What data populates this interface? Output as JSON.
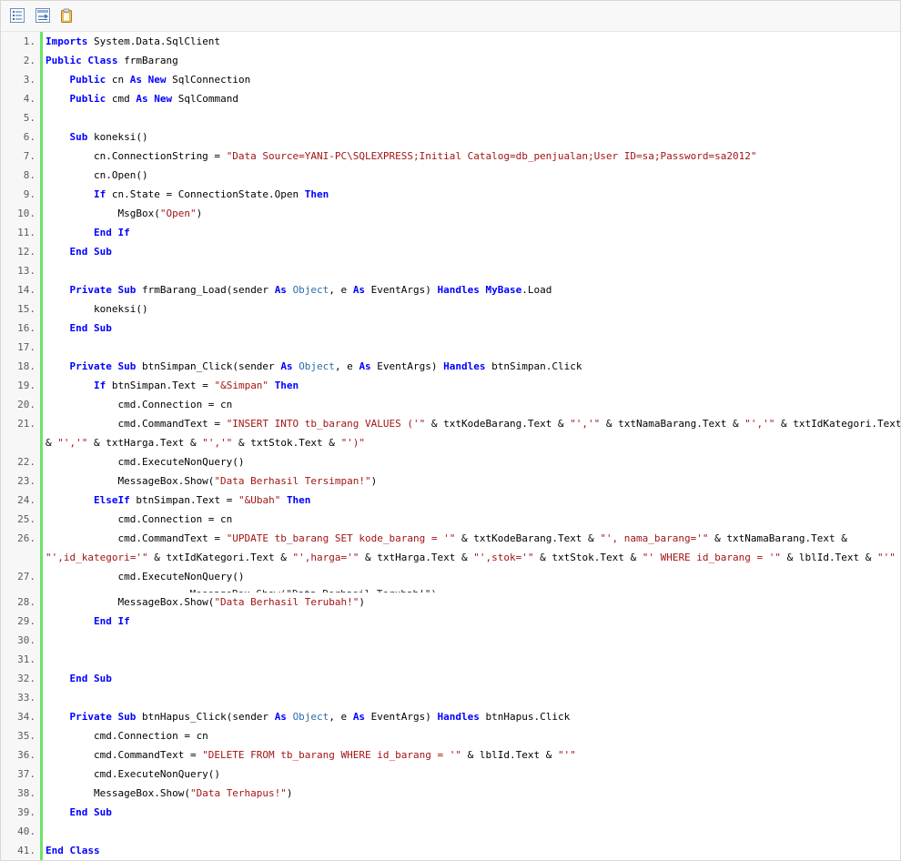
{
  "toolbar": {
    "buttons": [
      {
        "name": "view-source-icon"
      },
      {
        "name": "wrap-lines-icon"
      },
      {
        "name": "copy-clipboard-icon"
      }
    ]
  },
  "colors": {
    "keyword": "#0000ff",
    "type": "#2b6fa8",
    "string": "#a31515",
    "gutter_bar": "#6ce26c"
  },
  "code": {
    "lines": [
      {
        "n": "1.",
        "cont": "",
        "tokens": [
          {
            "c": "k",
            "t": "Imports"
          },
          {
            "c": "",
            "t": " System.Data.SqlClient"
          }
        ]
      },
      {
        "n": "2.",
        "cont": "",
        "tokens": [
          {
            "c": "k",
            "t": "Public"
          },
          {
            "c": "",
            "t": " "
          },
          {
            "c": "k",
            "t": "Class"
          },
          {
            "c": "",
            "t": " frmBarang"
          }
        ]
      },
      {
        "n": "3.",
        "cont": "",
        "tokens": [
          {
            "c": "",
            "t": "    "
          },
          {
            "c": "k",
            "t": "Public"
          },
          {
            "c": "",
            "t": " cn "
          },
          {
            "c": "k",
            "t": "As"
          },
          {
            "c": "",
            "t": " "
          },
          {
            "c": "k",
            "t": "New"
          },
          {
            "c": "",
            "t": " SqlConnection"
          }
        ]
      },
      {
        "n": "4.",
        "cont": "",
        "tokens": [
          {
            "c": "",
            "t": "    "
          },
          {
            "c": "k",
            "t": "Public"
          },
          {
            "c": "",
            "t": " cmd "
          },
          {
            "c": "k",
            "t": "As"
          },
          {
            "c": "",
            "t": " "
          },
          {
            "c": "k",
            "t": "New"
          },
          {
            "c": "",
            "t": " SqlCommand"
          }
        ]
      },
      {
        "n": "5.",
        "cont": "",
        "tokens": []
      },
      {
        "n": "6.",
        "cont": "",
        "tokens": [
          {
            "c": "",
            "t": "    "
          },
          {
            "c": "k",
            "t": "Sub"
          },
          {
            "c": "",
            "t": " koneksi()"
          }
        ]
      },
      {
        "n": "7.",
        "cont": "",
        "tokens": [
          {
            "c": "",
            "t": "        cn.ConnectionString = "
          },
          {
            "c": "s",
            "t": "\"Data Source=YANI-PC\\SQLEXPRESS;Initial Catalog=db_penjualan;User ID=sa;Password=sa2012\""
          }
        ]
      },
      {
        "n": "8.",
        "cont": "",
        "tokens": [
          {
            "c": "",
            "t": "        cn.Open()"
          }
        ]
      },
      {
        "n": "9.",
        "cont": "",
        "tokens": [
          {
            "c": "",
            "t": "        "
          },
          {
            "c": "k",
            "t": "If"
          },
          {
            "c": "",
            "t": " cn.State = ConnectionState.Open "
          },
          {
            "c": "k",
            "t": "Then"
          }
        ]
      },
      {
        "n": "10.",
        "cont": "",
        "tokens": [
          {
            "c": "",
            "t": "            MsgBox("
          },
          {
            "c": "s",
            "t": "\"Open\""
          },
          {
            "c": "",
            "t": ")"
          }
        ]
      },
      {
        "n": "11.",
        "cont": "",
        "tokens": [
          {
            "c": "",
            "t": "        "
          },
          {
            "c": "k",
            "t": "End"
          },
          {
            "c": "",
            "t": " "
          },
          {
            "c": "k",
            "t": "If"
          }
        ]
      },
      {
        "n": "12.",
        "cont": "",
        "tokens": [
          {
            "c": "",
            "t": "    "
          },
          {
            "c": "k",
            "t": "End"
          },
          {
            "c": "",
            "t": " "
          },
          {
            "c": "k",
            "t": "Sub"
          }
        ]
      },
      {
        "n": "13.",
        "cont": "",
        "tokens": []
      },
      {
        "n": "14.",
        "cont": "",
        "tokens": [
          {
            "c": "",
            "t": "    "
          },
          {
            "c": "k",
            "t": "Private"
          },
          {
            "c": "",
            "t": " "
          },
          {
            "c": "k",
            "t": "Sub"
          },
          {
            "c": "",
            "t": " frmBarang_Load(sender "
          },
          {
            "c": "k",
            "t": "As"
          },
          {
            "c": "",
            "t": " "
          },
          {
            "c": "t",
            "t": "Object"
          },
          {
            "c": "",
            "t": ", e "
          },
          {
            "c": "k",
            "t": "As"
          },
          {
            "c": "",
            "t": " EventArgs) "
          },
          {
            "c": "k",
            "t": "Handles"
          },
          {
            "c": "",
            "t": " "
          },
          {
            "c": "k",
            "t": "MyBase"
          },
          {
            "c": "",
            "t": ".Load"
          }
        ]
      },
      {
        "n": "15.",
        "cont": "",
        "tokens": [
          {
            "c": "",
            "t": "        koneksi()"
          }
        ]
      },
      {
        "n": "16.",
        "cont": "",
        "tokens": [
          {
            "c": "",
            "t": "    "
          },
          {
            "c": "k",
            "t": "End"
          },
          {
            "c": "",
            "t": " "
          },
          {
            "c": "k",
            "t": "Sub"
          }
        ]
      },
      {
        "n": "17.",
        "cont": "",
        "tokens": []
      },
      {
        "n": "18.",
        "cont": "",
        "tokens": [
          {
            "c": "",
            "t": "    "
          },
          {
            "c": "k",
            "t": "Private"
          },
          {
            "c": "",
            "t": " "
          },
          {
            "c": "k",
            "t": "Sub"
          },
          {
            "c": "",
            "t": " btnSimpan_Click(sender "
          },
          {
            "c": "k",
            "t": "As"
          },
          {
            "c": "",
            "t": " "
          },
          {
            "c": "t",
            "t": "Object"
          },
          {
            "c": "",
            "t": ", e "
          },
          {
            "c": "k",
            "t": "As"
          },
          {
            "c": "",
            "t": " EventArgs) "
          },
          {
            "c": "k",
            "t": "Handles"
          },
          {
            "c": "",
            "t": " btnSimpan.Click"
          }
        ]
      },
      {
        "n": "19.",
        "cont": "",
        "tokens": [
          {
            "c": "",
            "t": "        "
          },
          {
            "c": "k",
            "t": "If"
          },
          {
            "c": "",
            "t": " btnSimpan.Text = "
          },
          {
            "c": "s",
            "t": "\"&Simpan\""
          },
          {
            "c": "",
            "t": " "
          },
          {
            "c": "k",
            "t": "Then"
          }
        ]
      },
      {
        "n": "20.",
        "cont": "",
        "tokens": [
          {
            "c": "",
            "t": "            cmd.Connection = cn"
          }
        ]
      },
      {
        "n": "21.",
        "wrap": true,
        "tokens": [
          {
            "c": "",
            "t": "            cmd.CommandText = "
          },
          {
            "c": "s",
            "t": "\"INSERT INTO tb_barang VALUES ('\""
          },
          {
            "c": "",
            "t": " & txtKodeBarang.Text & "
          },
          {
            "c": "s",
            "t": "\"','\""
          },
          {
            "c": "",
            "t": " & txtNamaBarang.Text & "
          },
          {
            "c": "s",
            "t": "\"','\""
          },
          {
            "c": "",
            "t": " & txtIdKategori.Text"
          }
        ],
        "tokens2": [
          {
            "c": "",
            "t": "& "
          },
          {
            "c": "s",
            "t": "\"','\""
          },
          {
            "c": "",
            "t": " & txtHarga.Text & "
          },
          {
            "c": "s",
            "t": "\"','\""
          },
          {
            "c": "",
            "t": " & txtStok.Text & "
          },
          {
            "c": "s",
            "t": "\"')\""
          }
        ]
      },
      {
        "n": "22.",
        "cont": "",
        "tokens": [
          {
            "c": "",
            "t": "            cmd.ExecuteNonQuery()"
          }
        ]
      },
      {
        "n": "23.",
        "cont": "",
        "tokens": [
          {
            "c": "",
            "t": "            MessageBox.Show("
          },
          {
            "c": "s",
            "t": "\"Data Berhasil Tersimpan!\""
          },
          {
            "c": "",
            "t": ")"
          }
        ]
      },
      {
        "n": "24.",
        "cont": "",
        "tokens": [
          {
            "c": "",
            "t": "        "
          },
          {
            "c": "k",
            "t": "ElseIf"
          },
          {
            "c": "",
            "t": " btnSimpan.Text = "
          },
          {
            "c": "s",
            "t": "\"&Ubah\""
          },
          {
            "c": "",
            "t": " "
          },
          {
            "c": "k",
            "t": "Then"
          }
        ]
      },
      {
        "n": "25.",
        "cont": "",
        "tokens": [
          {
            "c": "",
            "t": "            cmd.Connection = cn"
          }
        ]
      },
      {
        "n": "26.",
        "wrap": true,
        "tokens": [
          {
            "c": "",
            "t": "            cmd.CommandText = "
          },
          {
            "c": "s",
            "t": "\"UPDATE tb_barang SET kode_barang = '\""
          },
          {
            "c": "",
            "t": " & txtKodeBarang.Text & "
          },
          {
            "c": "s",
            "t": "\"', nama_barang='\""
          },
          {
            "c": "",
            "t": " & txtNamaBarang.Text &"
          }
        ],
        "tokens2": [
          {
            "c": "s",
            "t": "\"',id_kategori='\""
          },
          {
            "c": "",
            "t": " & txtIdKategori.Text & "
          },
          {
            "c": "s",
            "t": "\"',harga='\""
          },
          {
            "c": "",
            "t": " & txtHarga.Text & "
          },
          {
            "c": "s",
            "t": "\"',stok='\""
          },
          {
            "c": "",
            "t": " & txtStok.Text & "
          },
          {
            "c": "s",
            "t": "\"' WHERE id_barang = '\""
          },
          {
            "c": "",
            "t": " & lblId.Text & "
          },
          {
            "c": "s",
            "t": "\"'\""
          }
        ]
      },
      {
        "n": "27.",
        "cont": "",
        "tokens": [
          {
            "c": "",
            "t": "            cmd.ExecuteNonQuery()"
          }
        ]
      },
      {
        "n": "28.",
        "cont": "",
        "tokens": [
          {
            "c": "",
            "t": "            MessageBox.Show("
          },
          {
            "c": "s",
            "t": "\"Data Berhasil Terubah!\""
          },
          {
            "c": "",
            "t": ")"
          }
        ]
      },
      {
        "n": "29.",
        "cont": "",
        "tokens": [
          {
            "c": "",
            "t": "        "
          },
          {
            "c": "k",
            "t": "End"
          },
          {
            "c": "",
            "t": " "
          },
          {
            "c": "k",
            "t": "If"
          }
        ]
      },
      {
        "n": "30.",
        "cont": "",
        "tokens": []
      },
      {
        "n": "31.",
        "cont": "",
        "tokens": []
      },
      {
        "n": "32.",
        "cont": "",
        "tokens": [
          {
            "c": "",
            "t": "    "
          },
          {
            "c": "k",
            "t": "End"
          },
          {
            "c": "",
            "t": " "
          },
          {
            "c": "k",
            "t": "Sub"
          }
        ]
      },
      {
        "n": "33.",
        "cont": "",
        "tokens": []
      },
      {
        "n": "34.",
        "cont": "",
        "tokens": [
          {
            "c": "",
            "t": "    "
          },
          {
            "c": "k",
            "t": "Private"
          },
          {
            "c": "",
            "t": " "
          },
          {
            "c": "k",
            "t": "Sub"
          },
          {
            "c": "",
            "t": " btnHapus_Click(sender "
          },
          {
            "c": "k",
            "t": "As"
          },
          {
            "c": "",
            "t": " "
          },
          {
            "c": "t",
            "t": "Object"
          },
          {
            "c": "",
            "t": ", e "
          },
          {
            "c": "k",
            "t": "As"
          },
          {
            "c": "",
            "t": " EventArgs) "
          },
          {
            "c": "k",
            "t": "Handles"
          },
          {
            "c": "",
            "t": " btnHapus.Click"
          }
        ]
      },
      {
        "n": "35.",
        "cont": "",
        "tokens": [
          {
            "c": "",
            "t": "        cmd.Connection = cn"
          }
        ]
      },
      {
        "n": "36.",
        "cont": "",
        "tokens": [
          {
            "c": "",
            "t": "        cmd.CommandText = "
          },
          {
            "c": "s",
            "t": "\"DELETE FROM tb_barang WHERE id_barang = '\""
          },
          {
            "c": "",
            "t": " & lblId.Text & "
          },
          {
            "c": "s",
            "t": "\"'\""
          }
        ]
      },
      {
        "n": "37.",
        "cont": "",
        "tokens": [
          {
            "c": "",
            "t": "        cmd.ExecuteNonQuery()"
          }
        ]
      },
      {
        "n": "38.",
        "cont": "",
        "tokens": [
          {
            "c": "",
            "t": "        MessageBox.Show("
          },
          {
            "c": "s",
            "t": "\"Data Terhapus!\""
          },
          {
            "c": "",
            "t": ")"
          }
        ]
      },
      {
        "n": "39.",
        "cont": "",
        "tokens": [
          {
            "c": "",
            "t": "    "
          },
          {
            "c": "k",
            "t": "End"
          },
          {
            "c": "",
            "t": " "
          },
          {
            "c": "k",
            "t": "Sub"
          }
        ]
      },
      {
        "n": "40.",
        "cont": "",
        "tokens": []
      },
      {
        "n": "41.",
        "cont": "",
        "tokens": [
          {
            "c": "k",
            "t": "End"
          },
          {
            "c": "",
            "t": " "
          },
          {
            "c": "k",
            "t": "Class"
          }
        ]
      }
    ],
    "ghost_text": "            MessageBox.Show(\"Data Berhasil Terubah!\")"
  }
}
